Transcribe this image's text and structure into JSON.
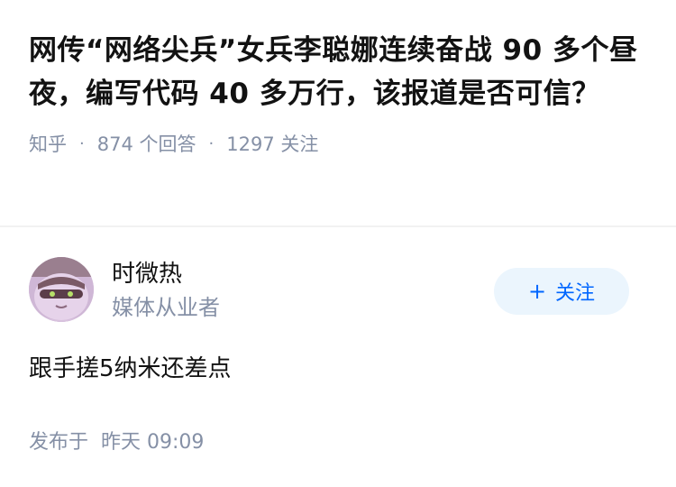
{
  "question": {
    "title": "网传“网络尖兵”女兵李聪娜连续奋战 90 多个昼夜，编写代码 40 多万行，该报道是否可信？",
    "source": "知乎",
    "answer_count": "874 个回答",
    "follower_count": "1297 关注",
    "separator": "·"
  },
  "answer": {
    "author": {
      "name": "时微热",
      "bio": "媒体从业者",
      "avatar_icon": "avatar-image"
    },
    "follow_button": {
      "icon": "plus-icon",
      "symbol": "+",
      "label": "关注"
    },
    "content": "跟手搓5纳米还差点",
    "published_label": "发布于",
    "published_time": "昨天 09:09"
  },
  "colors": {
    "title": "#121212",
    "meta": "#8590a6",
    "follow_bg": "#ebf5fd",
    "follow_text": "#0066ff",
    "divider": "#f2f2f2"
  }
}
